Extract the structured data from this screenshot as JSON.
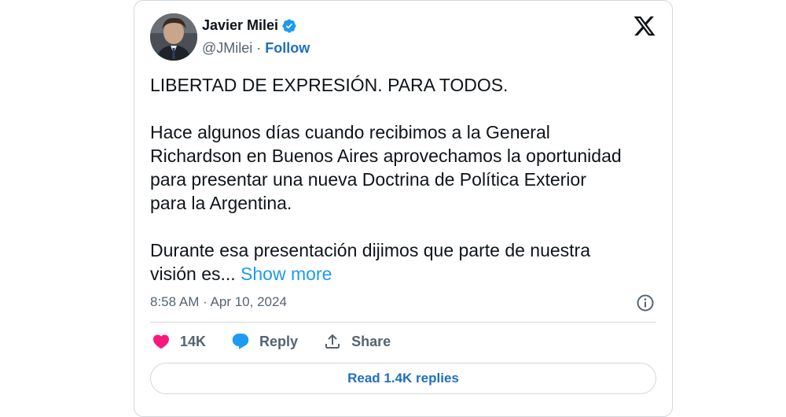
{
  "author": {
    "name": "Javier Milei",
    "handle": "@JMilei",
    "separator": " · ",
    "follow_label": "Follow",
    "verified": true
  },
  "tweet": {
    "paragraph_1": "LIBERTAD DE EXPRESIÓN. PARA TODOS.",
    "paragraph_2_line_1": "Hace algunos días cuando recibimos a la General",
    "paragraph_2_line_2": "Richardson en Buenos Aires aprovechamos la oportunidad",
    "paragraph_2_line_3": "para presentar una nueva Doctrina de Política Exterior",
    "paragraph_2_line_4": "para la Argentina.",
    "paragraph_3_line_1": "Durante esa presentación dijimos que parte de nuestra",
    "paragraph_3_line_2": "visión es...",
    "show_more_label": "Show more",
    "timestamp": "8:58 AM · Apr 10, 2024"
  },
  "actions": {
    "likes_count": "14K",
    "reply_label": "Reply",
    "share_label": "Share"
  },
  "read_replies_label": "Read 1.4K replies",
  "colors": {
    "like": "#f91880",
    "accent": "#1d9bf0",
    "link": "#1d6fc1",
    "verified": "#1d9bf0"
  },
  "icons": [
    "avatar",
    "verified-badge-icon",
    "x-logo-icon",
    "info-icon",
    "heart-icon",
    "reply-bubble-icon",
    "share-icon"
  ]
}
